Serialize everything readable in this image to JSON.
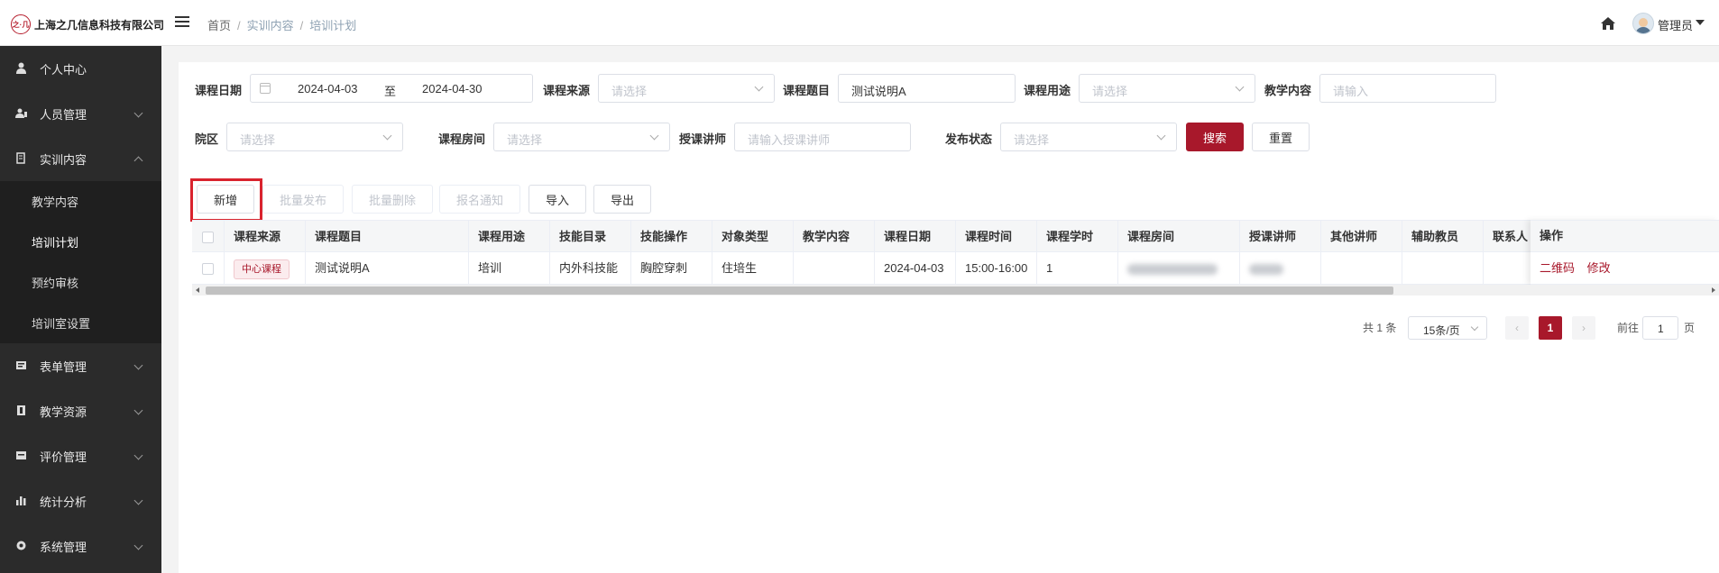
{
  "header": {
    "logo_mark": "之·几",
    "company": "上海之几信息科技有限公司",
    "breadcrumb": [
      "首页",
      "实训内容",
      "培训计划"
    ],
    "user_name": "管理员"
  },
  "sidebar": {
    "items": [
      {
        "label": "个人中心",
        "icon": "user-icon"
      },
      {
        "label": "人员管理",
        "icon": "users-icon"
      },
      {
        "label": "实训内容",
        "icon": "book-icon"
      },
      {
        "label": "表单管理",
        "icon": "form-icon"
      },
      {
        "label": "教学资源",
        "icon": "resource-icon"
      },
      {
        "label": "评价管理",
        "icon": "evaluation-icon"
      },
      {
        "label": "统计分析",
        "icon": "chart-icon"
      },
      {
        "label": "系统管理",
        "icon": "gear-icon"
      }
    ],
    "sub_items": [
      "教学内容",
      "培训计划",
      "预约审核",
      "培训室设置"
    ]
  },
  "filters": {
    "course_date_label": "课程日期",
    "date_start": "2024-04-03",
    "date_sep": "至",
    "date_end": "2024-04-30",
    "course_source_label": "课程来源",
    "course_source_placeholder": "请选择",
    "course_title_label": "课程题目",
    "course_title_value": "测试说明A",
    "course_use_label": "课程用途",
    "course_use_placeholder": "请选择",
    "teaching_content_label": "教学内容",
    "teaching_content_placeholder": "请输入",
    "campus_label": "院区",
    "campus_placeholder": "请选择",
    "room_label": "课程房间",
    "room_placeholder": "请选择",
    "lecturer_label": "授课讲师",
    "lecturer_placeholder": "请输入授课讲师",
    "publish_label": "发布状态",
    "publish_placeholder": "请选择",
    "search_btn": "搜索",
    "reset_btn": "重置"
  },
  "actions": {
    "add": "新增",
    "batch_publish": "批量发布",
    "batch_delete": "批量删除",
    "signup_notice": "报名通知",
    "import": "导入",
    "export": "导出"
  },
  "table": {
    "columns": [
      "课程来源",
      "课程题目",
      "课程用途",
      "技能目录",
      "技能操作",
      "对象类型",
      "教学内容",
      "课程日期",
      "课程时间",
      "课程学时",
      "课程房间",
      "授课讲师",
      "其他讲师",
      "辅助教员",
      "联系人",
      "操作"
    ],
    "rows": [
      {
        "source": "中心课程",
        "title": "测试说明A",
        "use": "培训",
        "skill_dir": "内外科技能",
        "skill_op": "胸腔穿刺",
        "target": "住培生",
        "content": "",
        "date": "2024-04-03",
        "time": "15:00-16:00",
        "hours": "1",
        "room": "",
        "lecturer": "",
        "other": "",
        "assist": "",
        "contact": "",
        "ops": [
          "二维码",
          "修改"
        ]
      }
    ]
  },
  "pagination": {
    "total": "共 1 条",
    "page_size": "15条/页",
    "current": "1",
    "goto_label": "前往",
    "goto_value": "1",
    "page_suffix": "页"
  }
}
